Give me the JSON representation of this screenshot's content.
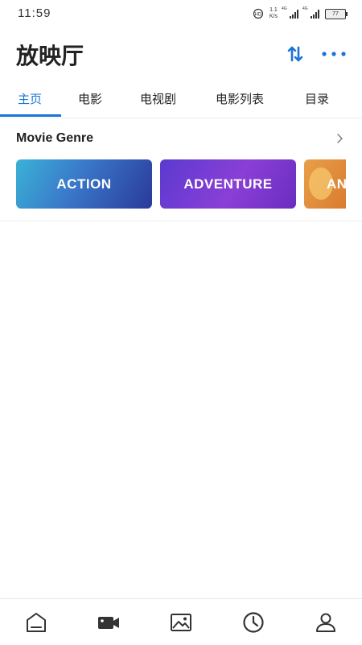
{
  "status_bar": {
    "time": "11:59",
    "speed_top": "1.1",
    "speed_bottom": "K/s",
    "signal_1_label": "4G",
    "signal_2_label": "4G",
    "battery": "77"
  },
  "header": {
    "title": "放映厅",
    "sort_icon": "sort-arrows-icon",
    "more_icon": "more-dots-icon",
    "accent_color": "#1a73d6"
  },
  "tabs": [
    {
      "label": "主页",
      "active": true
    },
    {
      "label": "电影",
      "active": false
    },
    {
      "label": "电视剧",
      "active": false
    },
    {
      "label": "电影列表",
      "active": false
    },
    {
      "label": "目录",
      "active": false
    }
  ],
  "genre_section": {
    "title": "Movie Genre",
    "cards": [
      {
        "label": "ACTION"
      },
      {
        "label": "ADVENTURE"
      },
      {
        "label": "AN"
      }
    ]
  },
  "bottom_nav": [
    {
      "icon": "home-icon"
    },
    {
      "icon": "video-camera-icon"
    },
    {
      "icon": "image-icon"
    },
    {
      "icon": "clock-icon"
    },
    {
      "icon": "profile-icon"
    }
  ]
}
